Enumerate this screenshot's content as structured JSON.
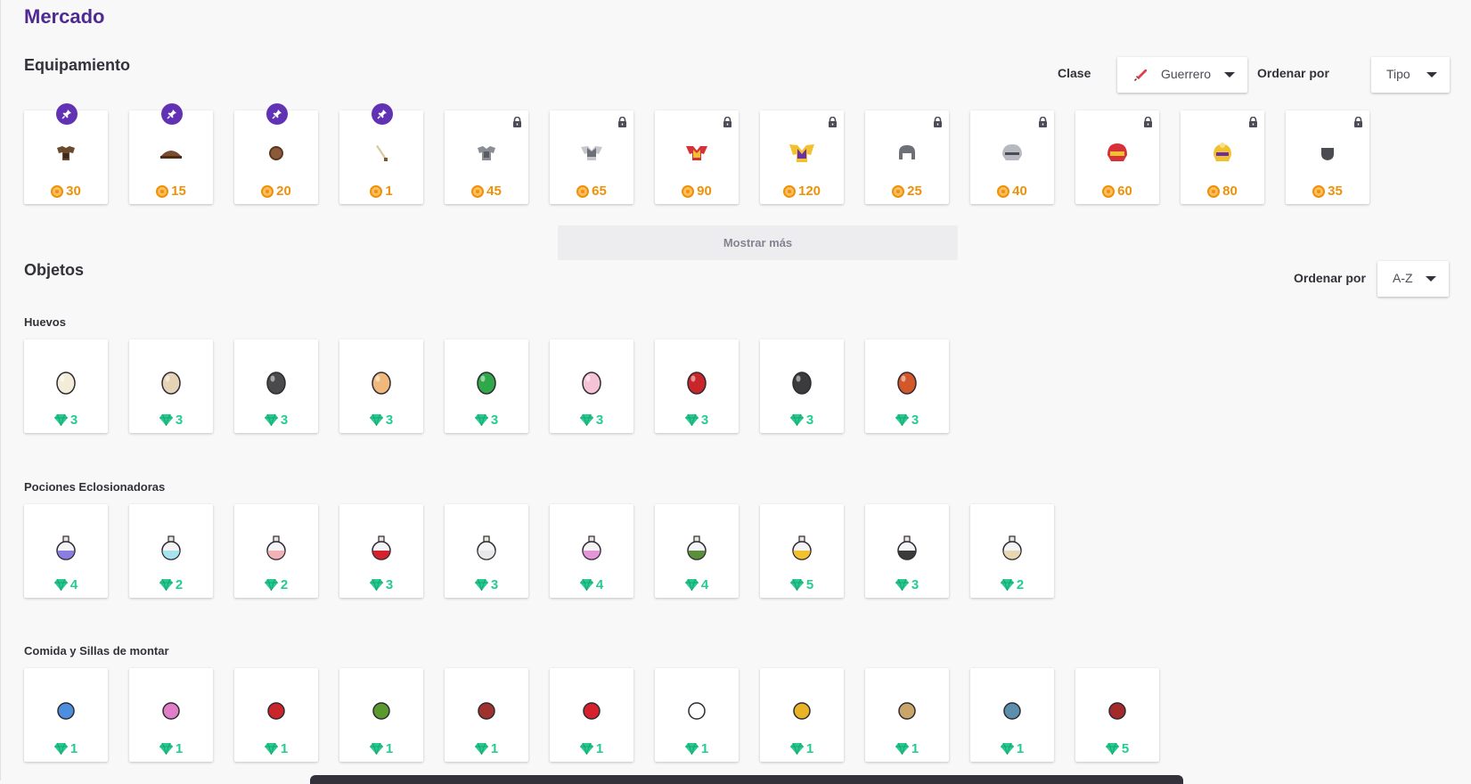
{
  "page_title": "Mercado",
  "equipment": {
    "title": "Equipamiento",
    "class_label": "Clase",
    "class_value": "Guerrero",
    "sort_label": "Ordenar por",
    "sort_value": "Tipo",
    "items": [
      {
        "name": "armor-item-icon",
        "price": "30",
        "pinned": true
      },
      {
        "name": "helmet-item-icon",
        "price": "15",
        "pinned": true
      },
      {
        "name": "shield-item-icon",
        "price": "20",
        "pinned": true
      },
      {
        "name": "sword-item-icon",
        "price": "1",
        "pinned": true
      },
      {
        "name": "leather-armor-icon",
        "price": "45",
        "locked": true
      },
      {
        "name": "chain-armor-icon",
        "price": "65",
        "locked": true
      },
      {
        "name": "red-armor-icon",
        "price": "90",
        "locked": true
      },
      {
        "name": "gold-armor-icon",
        "price": "120",
        "locked": true
      },
      {
        "name": "iron-helmet-icon",
        "price": "25",
        "locked": true
      },
      {
        "name": "steel-helmet-icon",
        "price": "40",
        "locked": true
      },
      {
        "name": "red-helmet-icon",
        "price": "60",
        "locked": true
      },
      {
        "name": "gold-helmet-icon",
        "price": "80",
        "locked": true
      },
      {
        "name": "iron-shield-icon",
        "price": "35",
        "locked": true
      }
    ],
    "show_more": "Mostrar más"
  },
  "objects": {
    "title": "Objetos",
    "sort_label": "Ordenar por",
    "sort_value": "A-Z",
    "eggs": {
      "title": "Huevos",
      "items": [
        {
          "name": "egg-base-icon",
          "color": "#f3ecd8",
          "price": "3"
        },
        {
          "name": "egg-spotted-icon",
          "color": "#e6d2b5",
          "price": "3"
        },
        {
          "name": "egg-skeleton-icon",
          "color": "#4a4a4a",
          "price": "3"
        },
        {
          "name": "egg-desert-icon",
          "color": "#f0b87a",
          "price": "3"
        },
        {
          "name": "egg-cactus-icon",
          "color": "#2fa84a",
          "price": "3"
        },
        {
          "name": "egg-cotton-candy-icon",
          "color": "#f6c3d6",
          "price": "3"
        },
        {
          "name": "egg-red-icon",
          "color": "#c9262b",
          "price": "3"
        },
        {
          "name": "egg-shade-icon",
          "color": "#3b3b3b",
          "price": "3"
        },
        {
          "name": "egg-fox-icon",
          "color": "#d4572a",
          "price": "3"
        }
      ]
    },
    "potions": {
      "title": "Pociones Eclosionadoras",
      "items": [
        {
          "name": "potion-cloud-icon",
          "color": "#8b7ee2",
          "price": "4"
        },
        {
          "name": "potion-cotton-icon",
          "color": "#a8e2ee",
          "price": "2"
        },
        {
          "name": "potion-pink-icon",
          "color": "#f3b1b6",
          "price": "2"
        },
        {
          "name": "potion-red-icon",
          "color": "#d6202e",
          "price": "3"
        },
        {
          "name": "potion-skeleton-icon",
          "color": "#e8e8e8",
          "price": "3"
        },
        {
          "name": "potion-cotton-candy-pink-icon",
          "color": "#e495d8",
          "price": "4"
        },
        {
          "name": "potion-zombie-icon",
          "color": "#5a8f3a",
          "price": "4"
        },
        {
          "name": "potion-golden-icon",
          "color": "#f2c12e",
          "price": "5"
        },
        {
          "name": "potion-shade-icon",
          "color": "#3a3a3a",
          "price": "3"
        },
        {
          "name": "potion-desert-icon",
          "color": "#e7d8b2",
          "price": "2"
        }
      ]
    },
    "food": {
      "title": "Comida y Sillas de montar",
      "items": [
        {
          "name": "cotton-candy-blue-icon",
          "color": "#4d8fdf",
          "price": "1"
        },
        {
          "name": "cotton-candy-pink-icon",
          "color": "#e07fc8",
          "price": "1"
        },
        {
          "name": "meat-icon",
          "color": "#c9262b",
          "price": "1"
        },
        {
          "name": "rotten-meat-icon",
          "color": "#5a9a2d",
          "price": "1"
        },
        {
          "name": "chocolate-icon",
          "color": "#a0322d",
          "price": "1"
        },
        {
          "name": "strawberry-icon",
          "color": "#d6202e",
          "price": "1"
        },
        {
          "name": "milk-icon",
          "color": "#ffffff",
          "price": "1"
        },
        {
          "name": "honey-icon",
          "color": "#e8b425",
          "price": "1"
        },
        {
          "name": "potato-icon",
          "color": "#c9a56a",
          "price": "1"
        },
        {
          "name": "fish-icon",
          "color": "#5c8fae",
          "price": "1"
        },
        {
          "name": "saddle-icon",
          "color": "#a32a2a",
          "price": "5"
        }
      ]
    }
  },
  "colors": {
    "brand": "#4f2a93",
    "gold": "#ee9109",
    "gem": "#24cc8f",
    "pin": "#6133b4"
  }
}
